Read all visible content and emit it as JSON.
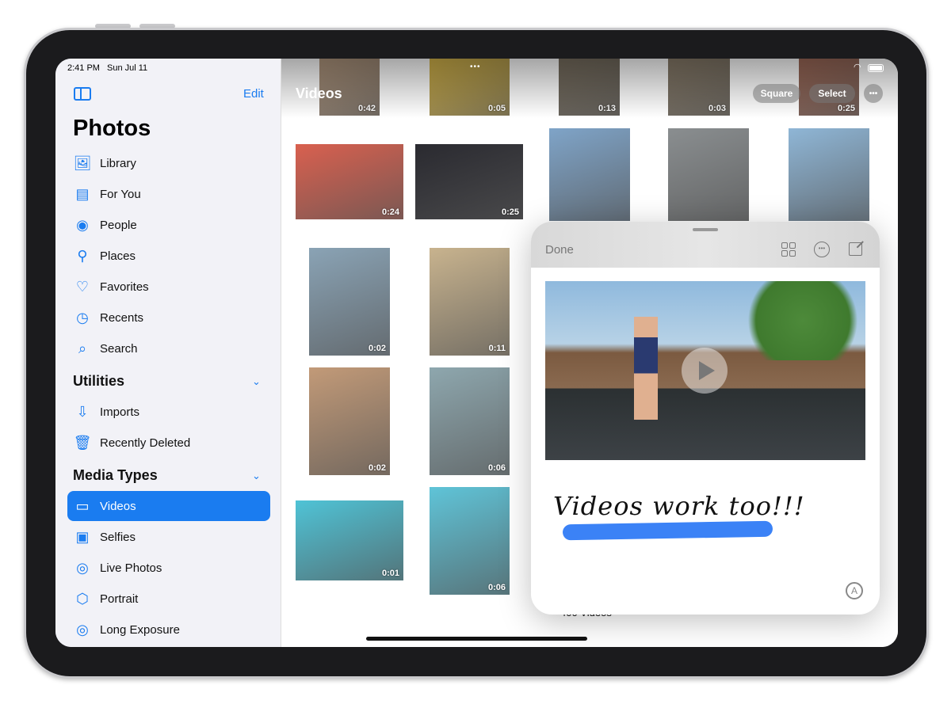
{
  "status_bar": {
    "time": "2:41 PM",
    "date": "Sun Jul 11",
    "wifi_icon": "wifi-icon",
    "battery_icon": "battery-icon"
  },
  "sidebar": {
    "edit_label": "Edit",
    "title": "Photos",
    "items": [
      {
        "label": "Library",
        "icon": "photo-stack-icon"
      },
      {
        "label": "For You",
        "icon": "for-you-icon"
      },
      {
        "label": "People",
        "icon": "person-circle-icon"
      },
      {
        "label": "Places",
        "icon": "map-pin-icon"
      },
      {
        "label": "Favorites",
        "icon": "heart-icon"
      },
      {
        "label": "Recents",
        "icon": "clock-icon"
      },
      {
        "label": "Search",
        "icon": "search-icon"
      }
    ],
    "utilities": {
      "title": "Utilities",
      "items": [
        {
          "label": "Imports",
          "icon": "import-icon"
        },
        {
          "label": "Recently Deleted",
          "icon": "trash-icon"
        }
      ]
    },
    "media_types": {
      "title": "Media Types",
      "items": [
        {
          "label": "Videos",
          "icon": "video-icon",
          "selected": true
        },
        {
          "label": "Selfies",
          "icon": "selfie-icon"
        },
        {
          "label": "Live Photos",
          "icon": "live-photo-icon"
        },
        {
          "label": "Portrait",
          "icon": "cube-icon"
        },
        {
          "label": "Long Exposure",
          "icon": "long-exposure-icon"
        }
      ]
    }
  },
  "main": {
    "title": "Videos",
    "square_label": "Square",
    "select_label": "Select",
    "footer_count": "400 Videos",
    "thumbnails": [
      {
        "duration": "0:42",
        "color": "#b59a80"
      },
      {
        "duration": "0:05",
        "color": "#d9b84a"
      },
      {
        "duration": "0:13",
        "color": "#7a7060"
      },
      {
        "duration": "0:03",
        "color": "#8a7d6a"
      },
      {
        "duration": "0:25",
        "color": "#a06a58"
      },
      {
        "duration": "0:24",
        "color": "#d9604f"
      },
      {
        "duration": "0:25",
        "color": "#2a2a30"
      },
      {
        "duration": "",
        "color": "#7fa4c8"
      },
      {
        "duration": "",
        "color": "#8a8e90"
      },
      {
        "duration": "",
        "color": "#8fb6d6"
      },
      {
        "duration": "0:02",
        "color": "#8aa3b5"
      },
      {
        "duration": "0:11",
        "color": "#c8b38e"
      },
      {
        "duration": "0:02",
        "color": "#c29a78"
      },
      {
        "duration": "0:06",
        "color": "#8ea7ae"
      },
      {
        "duration": "0:01",
        "color": "#4fc3d6"
      },
      {
        "duration": "0:06",
        "color": "#5fc4d8"
      }
    ]
  },
  "popup": {
    "done_label": "Done",
    "grid_icon": "grid-icon",
    "more_icon": "ellipsis-circle-icon",
    "compose_icon": "compose-icon",
    "handwriting": "Videos work too!!!",
    "markup_icon": "markup-pen-icon",
    "highlight_color": "#3b82f6"
  },
  "colors": {
    "accent": "#1a7cf0"
  }
}
